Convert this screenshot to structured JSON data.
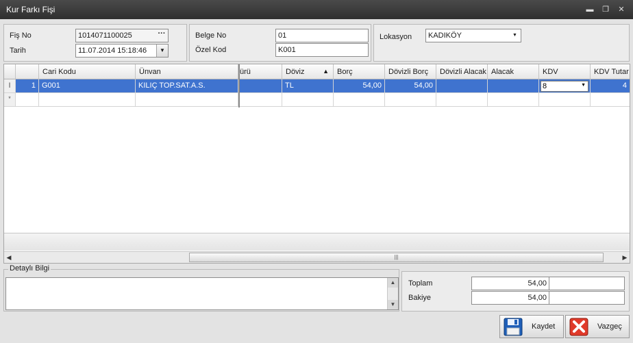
{
  "window": {
    "title": "Kur Farkı Fişi",
    "controls": [
      "▬",
      "❐",
      "✕"
    ]
  },
  "header": {
    "fis_no_label": "Fiş No",
    "fis_no_value": "1014071100025",
    "tarih_label": "Tarih",
    "tarih_value": "11.07.2014 15:18:46",
    "belge_no_label": "Belge No",
    "belge_no_value": "01",
    "ozel_kod_label": "Özel Kod",
    "ozel_kod_value": "K001",
    "lokasyon_label": "Lokasyon",
    "lokasyon_value": "KADIKÖY"
  },
  "grid": {
    "columns": [
      "",
      "",
      "Cari Kodu",
      "Ünvan",
      "ürü",
      "Döviz",
      "Borç",
      "Dövizli Borç",
      "Dövizli Alacak",
      "Alacak",
      "KDV",
      "KDV Tutar"
    ],
    "sort_indicator": "▲",
    "rows": [
      {
        "indicator": "I",
        "no": "1",
        "cari_kodu": "G001",
        "unvan": "KILIÇ TOP.SAT.A.S.",
        "turu": "",
        "doviz": "TL",
        "borc": "54,00",
        "dovizli_borc": "54,00",
        "dovizli_alacak": "",
        "alacak": "",
        "kdv": "8",
        "kdv_tutar": "4"
      }
    ],
    "new_row_indicator": "*"
  },
  "scrollbar": {
    "left_arrow": "◀",
    "right_arrow": "▶",
    "grip": "|||"
  },
  "detail": {
    "legend": "Detaylı Bilgi",
    "up_arrow": "▲",
    "down_arrow": "▼"
  },
  "totals": {
    "toplam_label": "Toplam",
    "toplam_value": "54,00",
    "bakiye_label": "Bakiye",
    "bakiye_value": "54,00"
  },
  "buttons": {
    "save_label": "Kaydet",
    "cancel_label": "Vazgeç"
  },
  "colors": {
    "selection": "#3f73cf",
    "titlebar": "#3a3a3a"
  }
}
